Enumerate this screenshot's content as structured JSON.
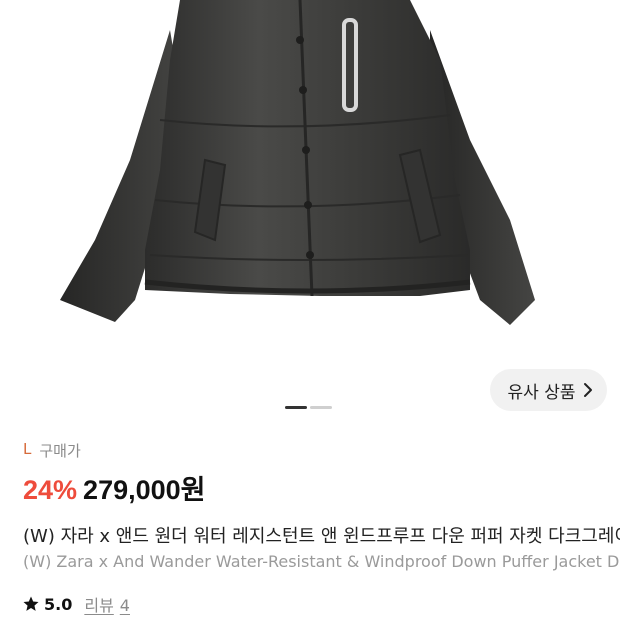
{
  "product": {
    "size": "L",
    "purchase_label": "구매가",
    "discount": "24%",
    "price": "279,000원",
    "title_ko": "(W) 자라 x 앤드 원더 워터 레지스턴트 앤 윈드프루프 다운 퍼퍼 자켓 다크그레이",
    "title_en": "(W) Zara x And Wander Water-Resistant & Windproof Down Puffer Jacket Dark Grey",
    "rating": "5.0",
    "review_label": "리뷰",
    "review_count": "4"
  },
  "gallery": {
    "similar_button_label": "유사 상품",
    "current_page": 1,
    "total_pages": 2
  },
  "colors": {
    "discount": "#ee4c3c",
    "jacket": "#3a3a38"
  },
  "icons": {
    "similar_arrow": "chevron-right-icon",
    "rating": "star-icon"
  }
}
